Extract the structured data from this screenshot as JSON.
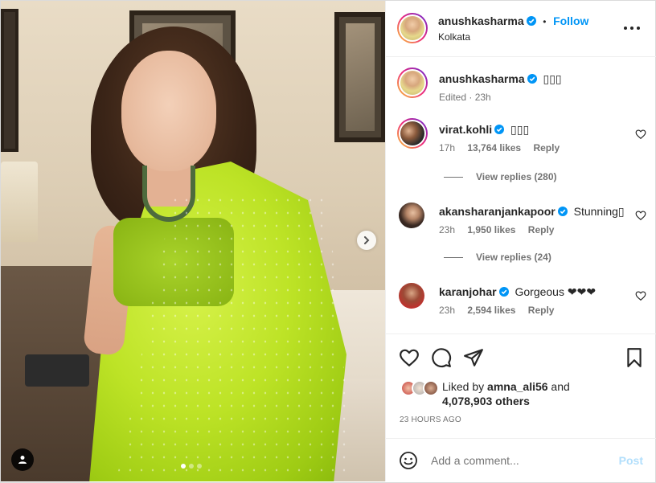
{
  "post": {
    "author": "anushkasharma",
    "follow_label": "Follow",
    "separator": "•",
    "location": "Kolkata"
  },
  "caption": {
    "username": "anushkasharma",
    "text": "▯▯▯",
    "meta": "Edited · 23h"
  },
  "comments": [
    {
      "username": "virat.kohli",
      "text": "▯▯▯",
      "time": "17h",
      "likes": "13,764 likes",
      "reply": "Reply",
      "verified": true,
      "view_replies": "View replies (280)"
    },
    {
      "username": "akansharanjankapoor",
      "text": "Stunning▯",
      "time": "23h",
      "likes": "1,950 likes",
      "reply": "Reply",
      "verified": true,
      "view_replies": "View replies (24)"
    },
    {
      "username": "karanjohar",
      "text": "Gorgeous ❤❤❤",
      "time": "23h",
      "likes": "2,594 likes",
      "reply": "Reply",
      "verified": true
    }
  ],
  "likes": {
    "liked_by_prefix": "Liked by ",
    "liked_by_user": "amna_ali56",
    "and_label": " and",
    "others": "4,078,903 others",
    "time_ago": "23 HOURS AGO"
  },
  "composer": {
    "placeholder": "Add a comment...",
    "post_label": "Post"
  },
  "carousel": {
    "total": 3,
    "current": 1
  },
  "colors": {
    "accent": "#0095f6",
    "verified": "#0095f6",
    "post_disabled": "#b2dffc",
    "muted": "#737373"
  }
}
